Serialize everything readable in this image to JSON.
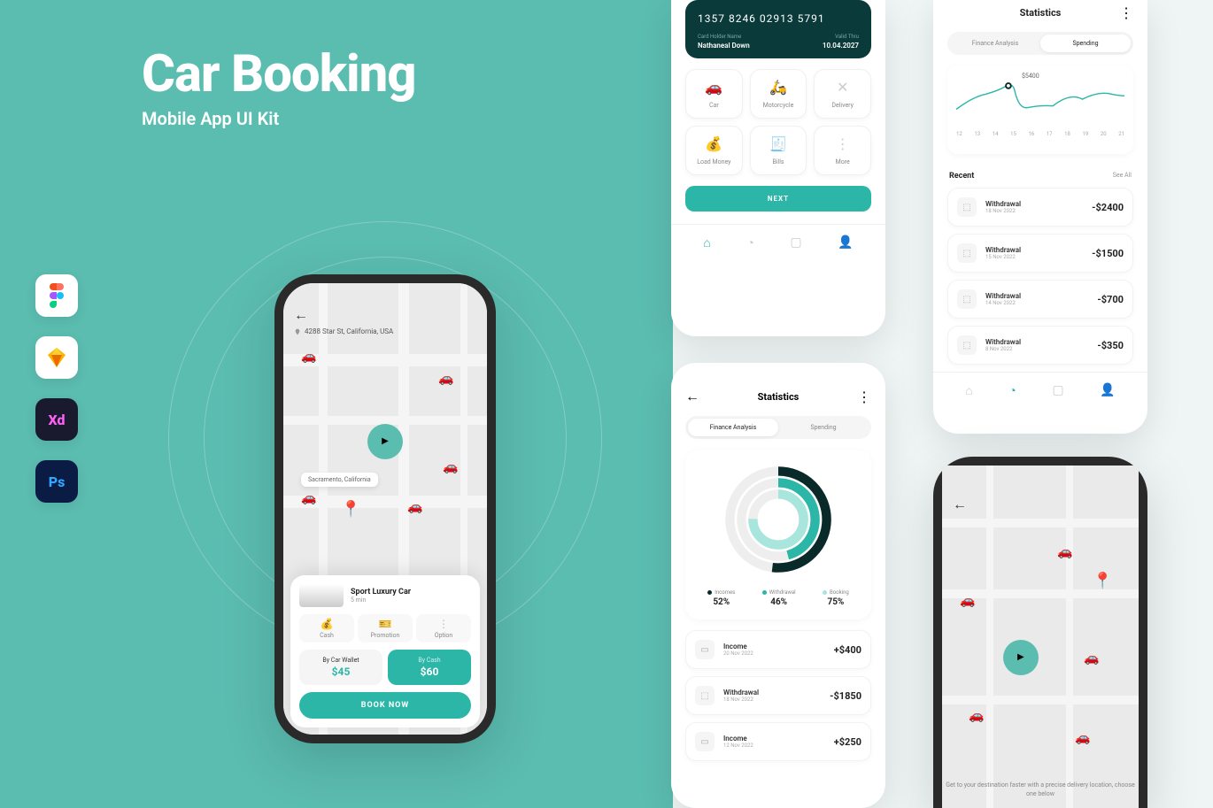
{
  "hero": {
    "title": "Car Booking",
    "subtitle": "Mobile App UI Kit"
  },
  "tools": [
    "figma",
    "sketch",
    "xd",
    "photoshop"
  ],
  "booking": {
    "address": "4288 Star St, California, USA",
    "location_label": "Sacramento, California",
    "car_name": "Sport Luxury Car",
    "car_eta": "5 min",
    "options": [
      {
        "icon": "wallet",
        "label": "Cash"
      },
      {
        "icon": "promo",
        "label": "Promotion"
      },
      {
        "icon": "more",
        "label": "Option"
      }
    ],
    "prices": [
      {
        "label": "By Car Wallet",
        "value": "$45"
      },
      {
        "label": "By Cash",
        "value": "$60"
      }
    ],
    "book_label": "BOOK NOW"
  },
  "wallet": {
    "card_number": "1357  8246  02913  5791",
    "holder_label": "Card Holder Name",
    "holder_name": "Nathaneal Down",
    "valid_label": "Valid Thru",
    "valid_date": "10.04.2027",
    "services": [
      {
        "icon": "car",
        "label": "Car"
      },
      {
        "icon": "moto",
        "label": "Motorcycle"
      },
      {
        "icon": "delivery",
        "label": "Delivery"
      },
      {
        "icon": "load",
        "label": "Load Money"
      },
      {
        "icon": "bills",
        "label": "Bills"
      },
      {
        "icon": "more",
        "label": "More"
      }
    ],
    "next_label": "NEXT"
  },
  "stats_top": {
    "title": "Statistics",
    "tabs": [
      "Finance Analysis",
      "Spending"
    ],
    "peak_value": "$5400",
    "x_labels": [
      "12",
      "13",
      "14",
      "15",
      "16",
      "17",
      "18",
      "19",
      "20",
      "21"
    ],
    "recent_title": "Recent",
    "see_all": "See All",
    "transactions": [
      {
        "name": "Withdrawal",
        "date": "18 Nov 2022",
        "amt": "-$2400"
      },
      {
        "name": "Withdrawal",
        "date": "15 Nov 2022",
        "amt": "-$1500"
      },
      {
        "name": "Withdrawal",
        "date": "14 Nov 2022",
        "amt": "-$700"
      },
      {
        "name": "Withdrawal",
        "date": "8 Nov 2022",
        "amt": "-$350"
      }
    ]
  },
  "stats_mid": {
    "title": "Statistics",
    "tabs": [
      "Finance Analysis",
      "Spending"
    ],
    "legend": [
      {
        "color": "#0a2a2a",
        "label": "Incomes",
        "value": "52%"
      },
      {
        "color": "#2bb6a8",
        "label": "Withdrawal",
        "value": "46%"
      },
      {
        "color": "#a8e5dc",
        "label": "Booking",
        "value": "75%"
      }
    ],
    "transactions": [
      {
        "name": "Income",
        "date": "20 Nov 2022",
        "amt": "+$400"
      },
      {
        "name": "Withdrawal",
        "date": "18 Nov 2022",
        "amt": "-$1850"
      },
      {
        "name": "Income",
        "date": "12 Nov 2022",
        "amt": "+$250"
      }
    ]
  },
  "map_panel": {
    "promo": "Get to your destination faster with a precise delivery location, choose one below"
  },
  "chart_data": [
    {
      "type": "line",
      "title": "Spending",
      "x": [
        12,
        13,
        14,
        15,
        16,
        17,
        18,
        19,
        20,
        21
      ],
      "values": [
        3800,
        4400,
        5400,
        3200,
        3600,
        3400,
        4600,
        4200,
        4800,
        4700
      ],
      "peak": 5400,
      "ylim": [
        3000,
        5600
      ]
    },
    {
      "type": "pie",
      "title": "Finance Analysis",
      "series": [
        {
          "name": "Incomes",
          "value": 52,
          "color": "#0a2a2a"
        },
        {
          "name": "Withdrawal",
          "value": 46,
          "color": "#2bb6a8"
        },
        {
          "name": "Booking",
          "value": 75,
          "color": "#a8e5dc"
        }
      ]
    }
  ]
}
